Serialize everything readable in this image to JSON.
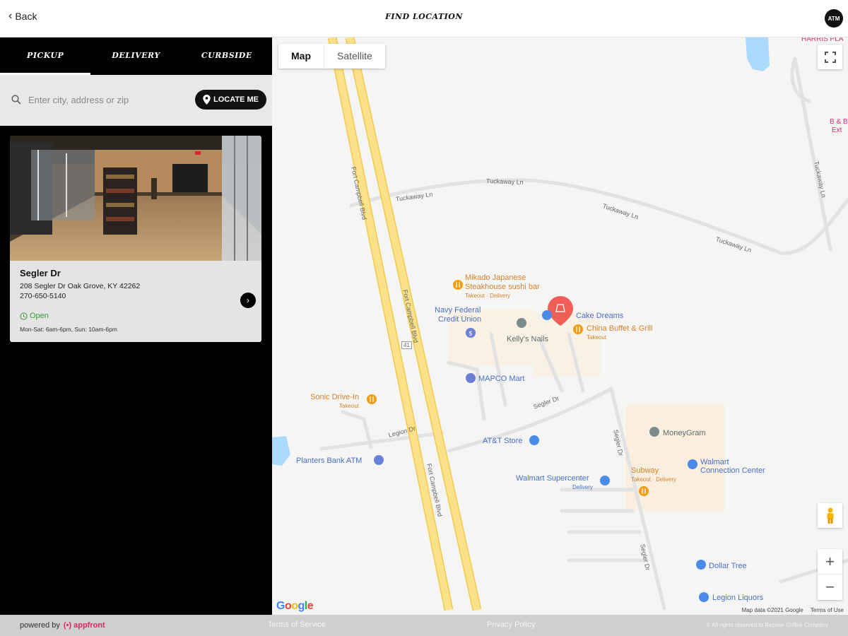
{
  "header": {
    "back_label": "Back",
    "title": "FIND LOCATION",
    "logo_text": "ATM"
  },
  "tabs": [
    {
      "label": "PICKUP",
      "active": true
    },
    {
      "label": "DELIVERY",
      "active": false
    },
    {
      "label": "CURBSIDE",
      "active": false
    }
  ],
  "search": {
    "placeholder": "Enter city, address or zip",
    "locate_label": "LOCATE ME"
  },
  "store": {
    "name": "Segler Dr",
    "address": "208 Segler Dr Oak Grove, KY 42262",
    "phone": "270-650-5140",
    "status": "Open",
    "hours": "Mon-Sat: 6am-6pm, Sun: 10am-6pm"
  },
  "map": {
    "type_map": "Map",
    "type_satellite": "Satellite",
    "google": "Google",
    "attribution": "Map data ©2021 Google",
    "terms": "Terms of Use",
    "places": {
      "mikado_1": "Mikado Japanese",
      "mikado_2": "Steakhouse sushi bar",
      "mikado_sub": "Takeout · Delivery",
      "navy_1": "Navy Federal",
      "navy_2": "Credit Union",
      "cake": "Cake Dreams",
      "china": "China Buffet & Grill",
      "china_sub": "Takeout",
      "kellys": "Kelly's Nails",
      "mapco": "MAPCO Mart",
      "sonic": "Sonic Drive-In",
      "sonic_sub": "Takeout",
      "att": "AT&T Store",
      "planters": "Planters Bank ATM",
      "moneygram": "MoneyGram",
      "walmart_cc_1": "Walmart",
      "walmart_cc_2": "Connection Center",
      "subway": "Subway",
      "subway_sub": "Takeout · Delivery",
      "walmart_sc": "Walmart Supercenter",
      "walmart_sc_sub": "Delivery",
      "dollar": "Dollar Tree",
      "legion": "Legion Liquors",
      "harris": "HARRIS PLA",
      "bb": "B & B",
      "ext": "Ext"
    },
    "roads": {
      "tuckaway_1": "Tuckaway Ln",
      "tuckaway_2": "Tuckaway Ln",
      "tuckaway_3": "Tuckaway Ln",
      "tuckaway_4": "Tuckaway Ln",
      "tuckaway_5": "Tuckaway Ln",
      "fcb_1": "Fort Campbell Blvd",
      "fcb_2": "Fort Campbell Blvd",
      "fcb_3": "Fort Campbell Blvd",
      "segler_1": "Segler Dr",
      "segler_2": "Segler Dr",
      "segler_3": "Segler Dr",
      "legion": "Legion Dr",
      "hwy": "41"
    }
  },
  "footer": {
    "powered_by": "powered by",
    "brand": "(•) appfront",
    "terms": "Terms of Service",
    "privacy": "Privacy Policy",
    "copyright": "© All rights reserved to Repose Coffee Company"
  },
  "colors": {
    "road_major": "#fbe18a",
    "road_major_edge": "#f2c94c",
    "accent_pink": "#e0245e",
    "open_green": "#3a9a3a"
  }
}
